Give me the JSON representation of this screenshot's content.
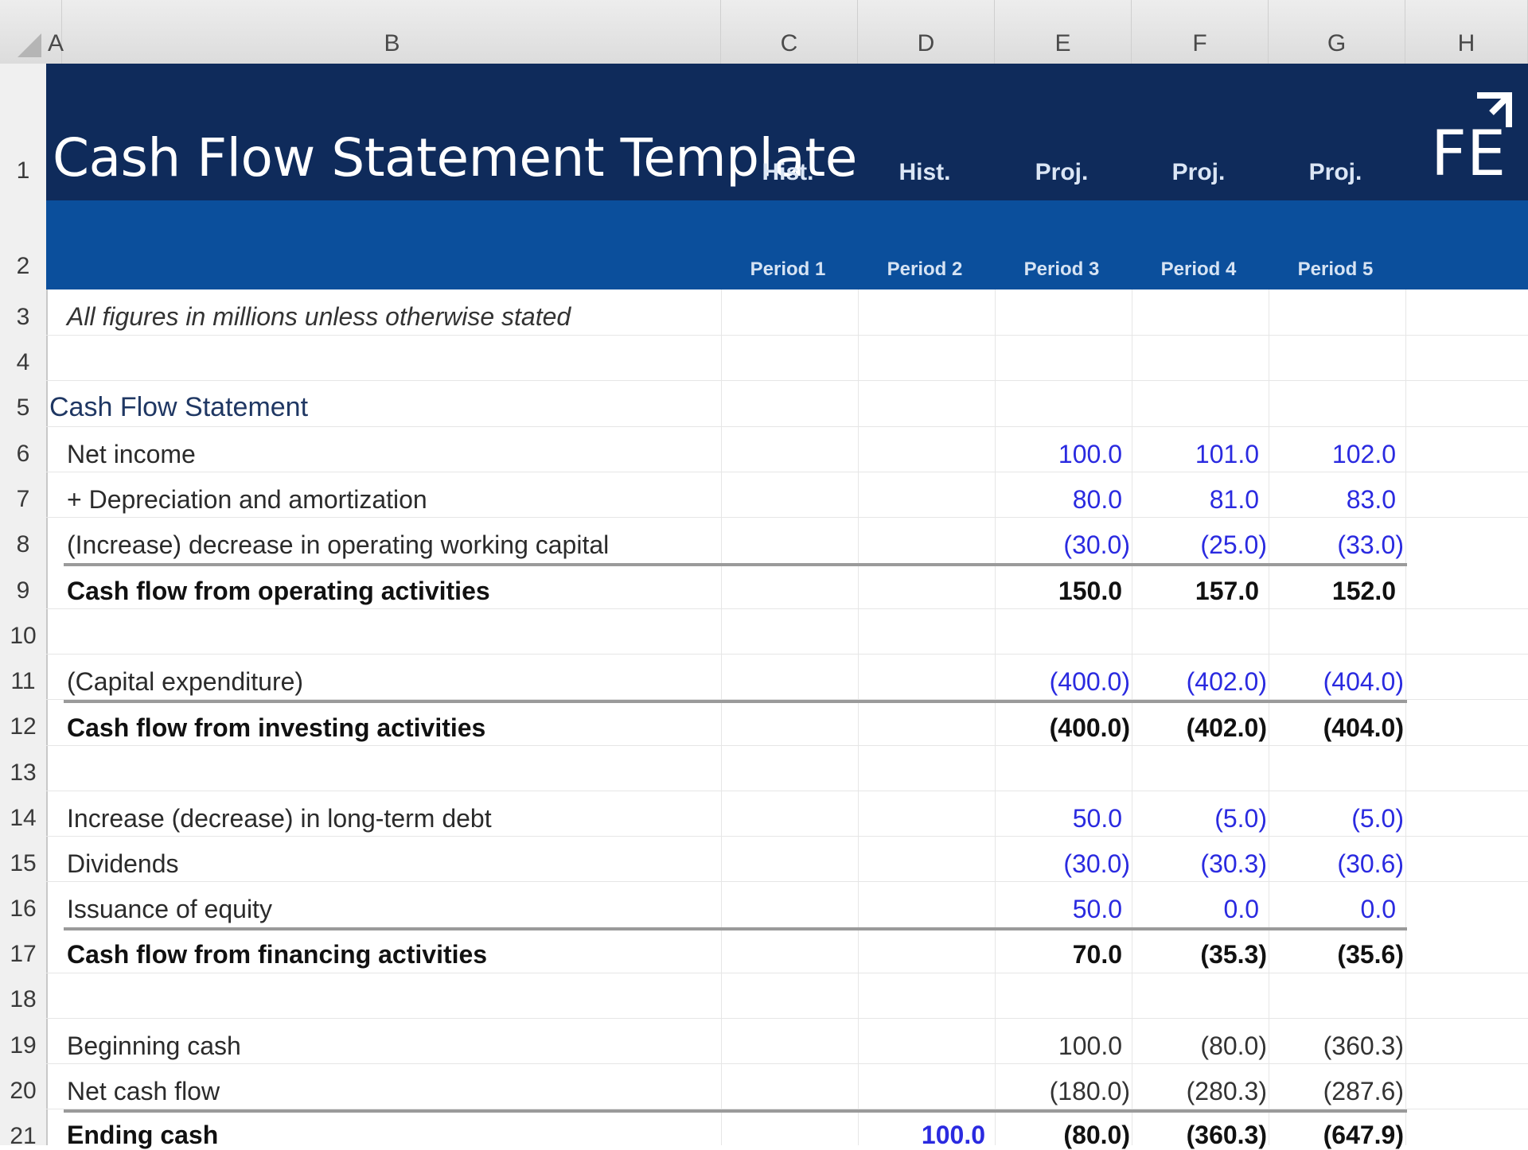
{
  "columns": [
    "A",
    "B",
    "C",
    "D",
    "E",
    "F",
    "G",
    "H"
  ],
  "rows": [
    "1",
    "2",
    "3",
    "4",
    "5",
    "6",
    "7",
    "8",
    "9",
    "10",
    "11",
    "12",
    "13",
    "14",
    "15",
    "16",
    "17",
    "18",
    "19",
    "20",
    "21"
  ],
  "title": "Cash Flow Statement Template",
  "header_types": [
    "Hist.",
    "Hist.",
    "Proj.",
    "Proj.",
    "Proj."
  ],
  "periods": [
    "Period 1",
    "Period 2",
    "Period 3",
    "Period 4",
    "Period 5"
  ],
  "logo_text": "FE",
  "units_note": "All figures in millions unless otherwise stated",
  "section_title": "Cash Flow Statement",
  "lines": {
    "net_income": {
      "label": "Net income",
      "E": "100.0",
      "F": "101.0",
      "G": "102.0"
    },
    "dep_amort": {
      "label": "+ Depreciation and amortization",
      "E": "80.0",
      "F": "81.0",
      "G": "83.0"
    },
    "working_capital": {
      "label": "(Increase) decrease in operating working capital",
      "E": "(30.0)",
      "F": "(25.0)",
      "G": "(33.0)"
    },
    "cfo": {
      "label": "Cash flow from operating activities",
      "E": "150.0",
      "F": "157.0",
      "G": "152.0"
    },
    "capex": {
      "label": "(Capital expenditure)",
      "E": "(400.0)",
      "F": "(402.0)",
      "G": "(404.0)"
    },
    "cfi": {
      "label": "Cash flow from investing activities",
      "E": "(400.0)",
      "F": "(402.0)",
      "G": "(404.0)"
    },
    "debt": {
      "label": "Increase (decrease) in long-term debt",
      "E": "50.0",
      "F": "(5.0)",
      "G": "(5.0)"
    },
    "dividends": {
      "label": "Dividends",
      "E": "(30.0)",
      "F": "(30.3)",
      "G": "(30.6)"
    },
    "equity": {
      "label": "Issuance of equity",
      "E": "50.0",
      "F": "0.0",
      "G": "0.0"
    },
    "cff": {
      "label": "Cash flow from financing activities",
      "E": "70.0",
      "F": "(35.3)",
      "G": "(35.6)"
    },
    "beginning_cash": {
      "label": "Beginning cash",
      "E": "100.0",
      "F": "(80.0)",
      "G": "(360.3)"
    },
    "net_cash_flow": {
      "label": "Net cash flow",
      "E": "(180.0)",
      "F": "(280.3)",
      "G": "(287.6)"
    },
    "ending_cash": {
      "label": "Ending cash",
      "D": "100.0",
      "E": "(80.0)",
      "F": "(360.3)",
      "G": "(647.9)"
    }
  },
  "colors": {
    "banner_dark": "#0f2b5b",
    "banner_blue": "#0b4f9c",
    "input_blue": "#2a2ae0"
  }
}
